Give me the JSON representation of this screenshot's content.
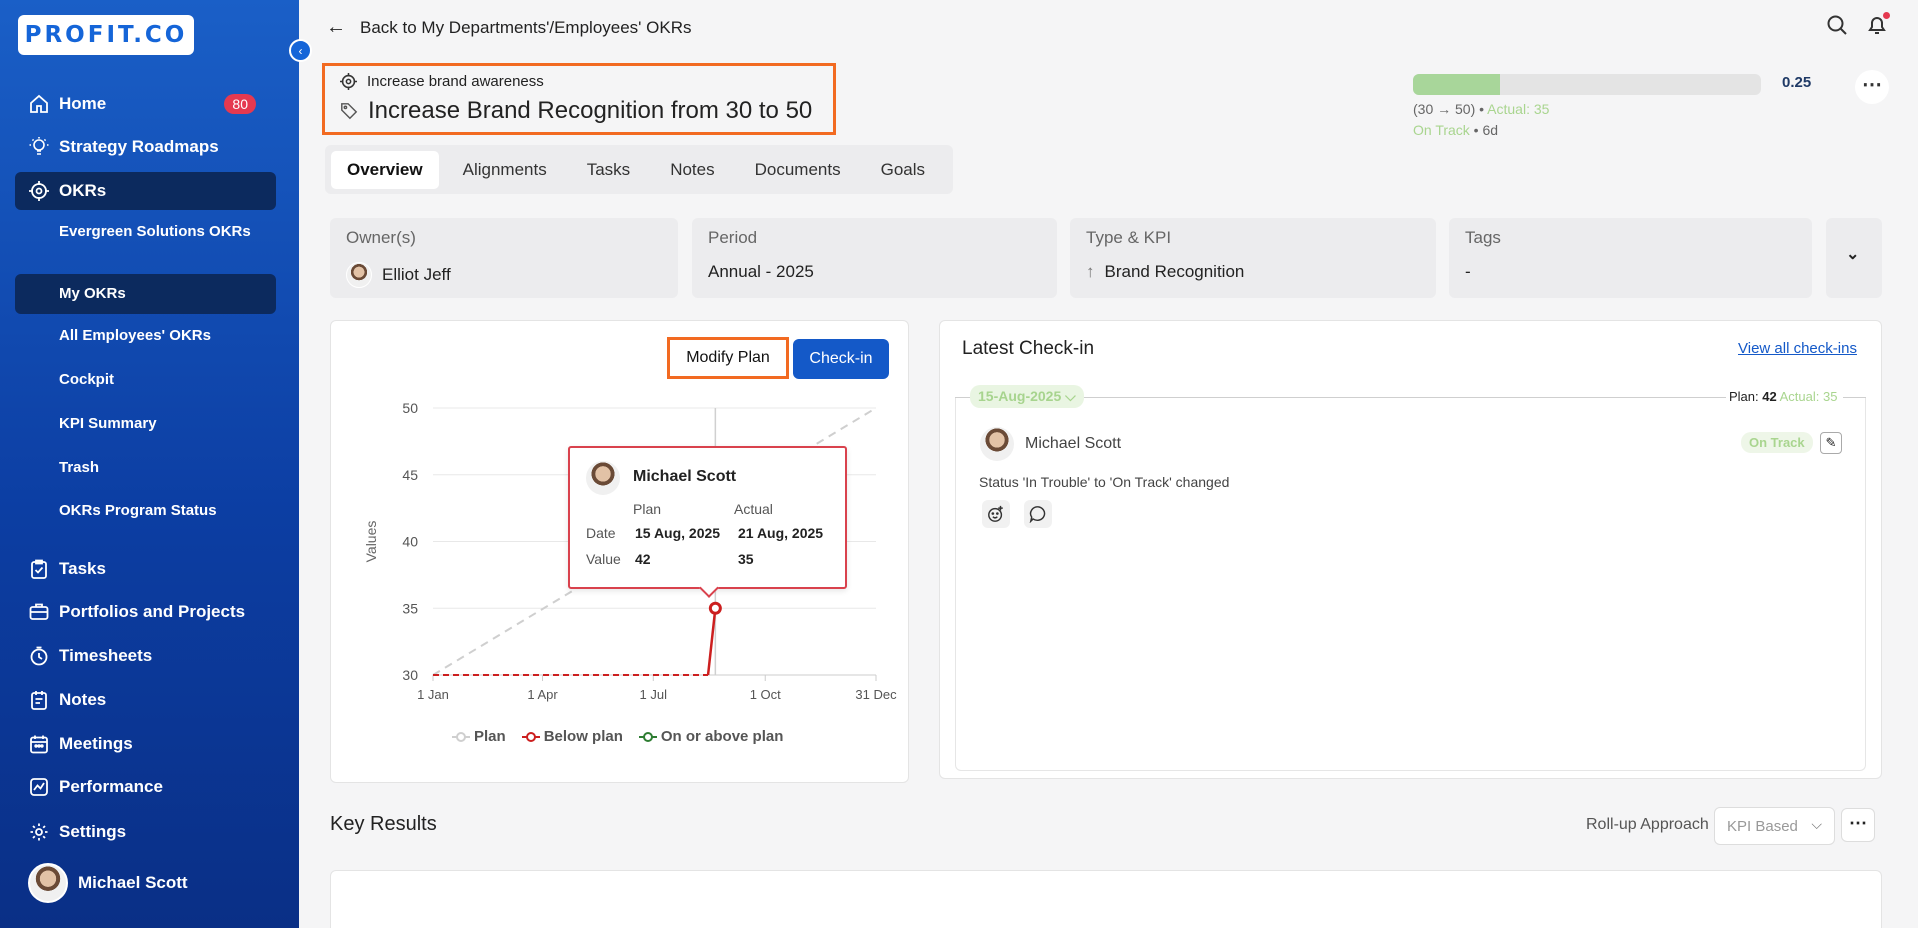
{
  "brand": {
    "logo_text": "PROFIT.CO"
  },
  "sidebar": {
    "items": [
      {
        "label": "Home",
        "badge": "80"
      },
      {
        "label": "Strategy Roadmaps"
      },
      {
        "label": "OKRs"
      },
      {
        "label": "Tasks"
      },
      {
        "label": "Portfolios and Projects"
      },
      {
        "label": "Timesheets"
      },
      {
        "label": "Notes"
      },
      {
        "label": "Meetings"
      },
      {
        "label": "Performance"
      },
      {
        "label": "Settings"
      }
    ],
    "okr_subitems": [
      "Evergreen Solutions OKRs",
      "My OKRs",
      "All Employees' OKRs",
      "Cockpit",
      "KPI Summary",
      "Trash",
      "OKRs Program Status"
    ],
    "user_name": "Michael Scott"
  },
  "topbar": {
    "back_label": "Back to My Departments'/Employees' OKRs"
  },
  "objective": {
    "parent": "Increase brand awareness",
    "title": "Increase Brand Recognition from 30 to 50",
    "progress": 0.25,
    "progress_label": "0.25",
    "range": "(30 → 50)",
    "actual": "Actual: 35",
    "status": "On Track",
    "days": "6d"
  },
  "tabs": [
    "Overview",
    "Alignments",
    "Tasks",
    "Notes",
    "Documents",
    "Goals"
  ],
  "info": {
    "owner_label": "Owner(s)",
    "owner_value": "Elliot Jeff",
    "period_label": "Period",
    "period_value": "Annual - 2025",
    "type_label": "Type & KPI",
    "type_value": "Brand Recognition",
    "tags_label": "Tags",
    "tags_value": "-"
  },
  "chart_panel": {
    "modify_label": "Modify Plan",
    "checkin_label": "Check-in",
    "ylabel": "Values",
    "legend": [
      "Plan",
      "Below plan",
      "On or above plan"
    ],
    "tooltip": {
      "name": "Michael Scott",
      "plan_header": "Plan",
      "actual_header": "Actual",
      "date_label": "Date",
      "value_label": "Value",
      "plan_date": "15 Aug, 2025",
      "actual_date": "21 Aug, 2025",
      "plan_value": "42",
      "actual_value": "35"
    }
  },
  "chart_data": {
    "type": "line",
    "ylabel": "Values",
    "ylim": [
      30,
      50
    ],
    "yticks": [
      30,
      35,
      40,
      45,
      50
    ],
    "xticks": [
      "1 Jan",
      "1 Apr",
      "1 Jul",
      "1 Oct",
      "31 Dec"
    ],
    "x_range": [
      "2025-01-01",
      "2025-12-31"
    ],
    "series": [
      {
        "name": "Plan",
        "color": "#cfcfcf",
        "dashed": true,
        "points": [
          [
            "2025-01-01",
            30
          ],
          [
            "2025-12-31",
            50
          ]
        ]
      },
      {
        "name": "Below plan",
        "color": "#cc1f1f",
        "points": [
          [
            "2025-01-01",
            30
          ],
          [
            "2025-08-15",
            30
          ],
          [
            "2025-08-21",
            35
          ]
        ]
      }
    ],
    "legend": [
      "Plan",
      "Below plan",
      "On or above plan"
    ],
    "legend_colors": [
      "#cfcfcf",
      "#cc1f1f",
      "#2e7d32"
    ],
    "grid": true,
    "legend_position": "bottom"
  },
  "checkin": {
    "title": "Latest Check-in",
    "view_all": "View all check-ins",
    "date": "15-Aug-2025",
    "plan_label": "Plan:",
    "plan_value": "42",
    "actual": "Actual: 35",
    "user": "Michael Scott",
    "status": "On Track",
    "message": "Status 'In Trouble' to 'On Track' changed"
  },
  "key_results": {
    "title": "Key Results",
    "rollup_label": "Roll-up Approach",
    "rollup_value": "KPI Based"
  }
}
